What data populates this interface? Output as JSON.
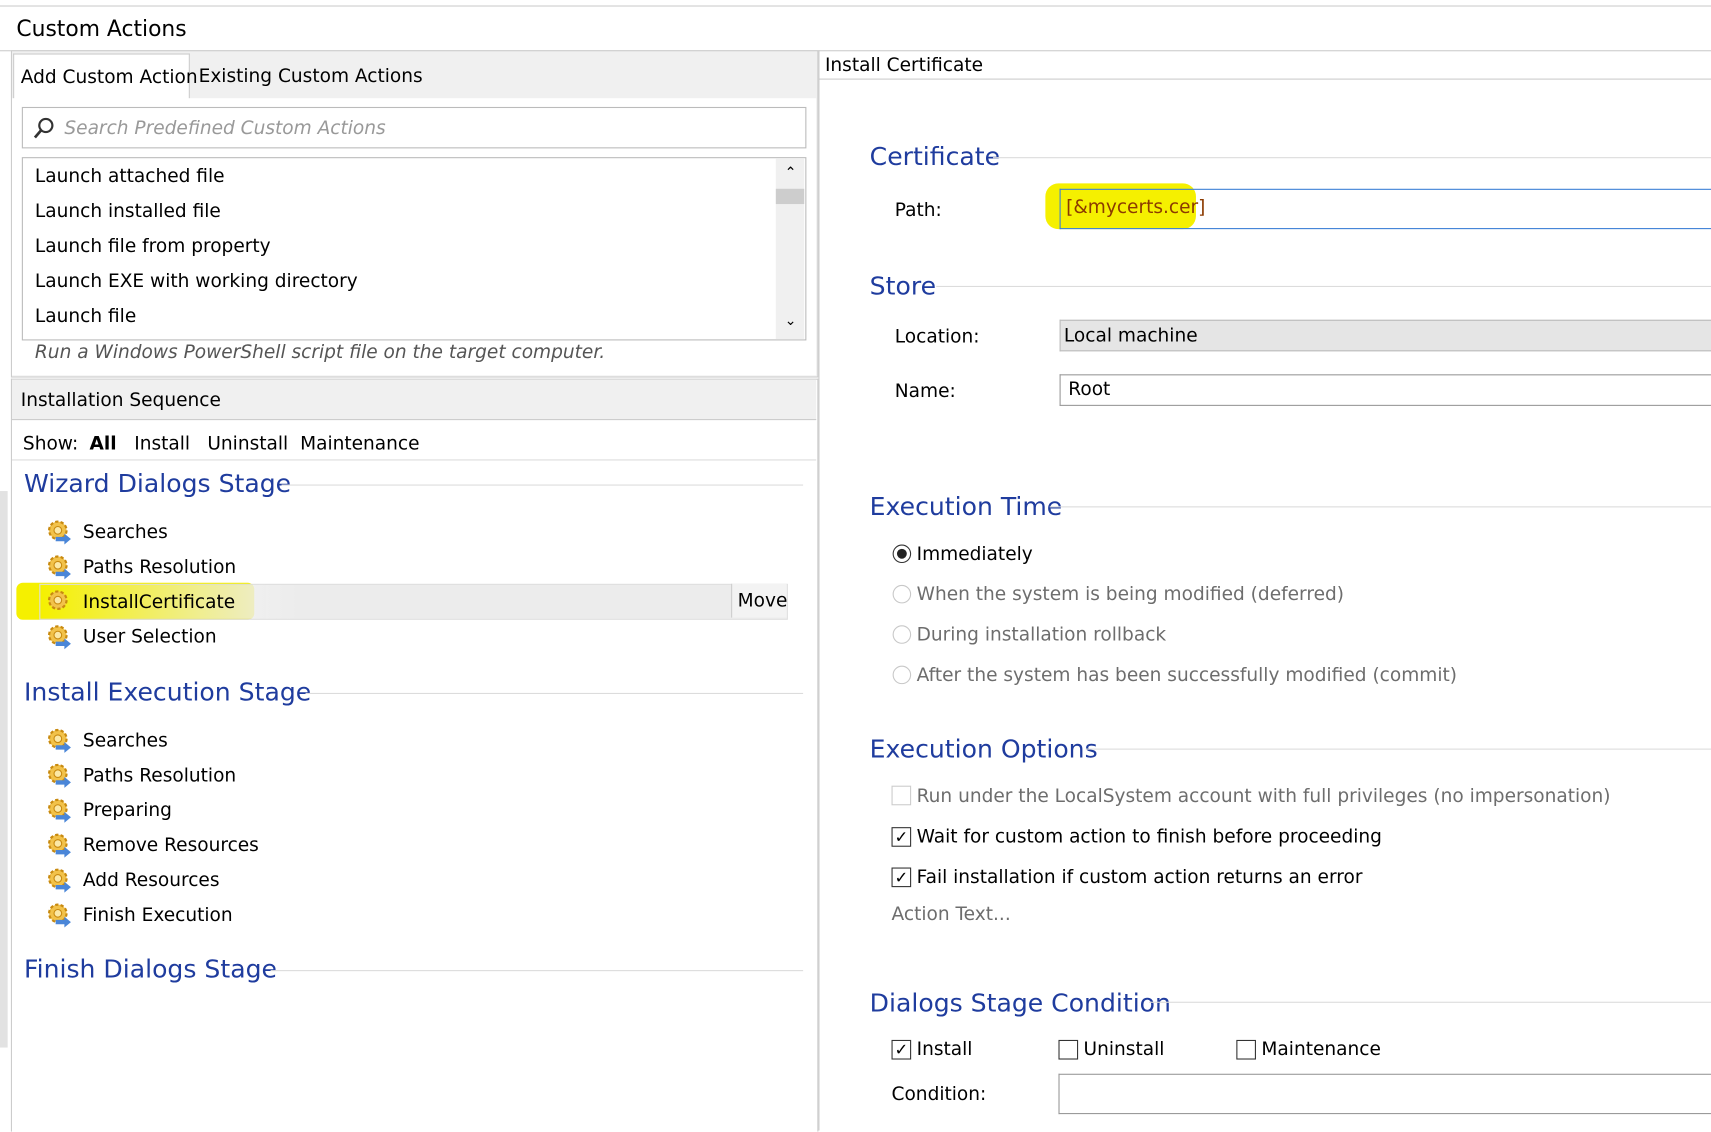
{
  "header": {
    "title": "Custom Actions"
  },
  "tabs": [
    {
      "label": "Add Custom Action",
      "active": true
    },
    {
      "label": "Existing Custom Actions",
      "active": false
    }
  ],
  "search": {
    "placeholder": "Search Predefined Custom Actions",
    "icon": "search-icon"
  },
  "predefined_list": [
    "Launch attached file",
    "Launch installed file",
    "Launch file from property",
    "Launch EXE with working directory",
    "Launch file"
  ],
  "description": "Run a Windows PowerShell script file on the target computer.",
  "sequence": {
    "title": "Installation Sequence",
    "show_label": "Show:",
    "filters": [
      {
        "label": "All",
        "active": true
      },
      {
        "label": "Install"
      },
      {
        "label": "Uninstall"
      },
      {
        "label": "Maintenance"
      }
    ],
    "stages": [
      {
        "title": "Wizard Dialogs Stage",
        "items": [
          "Searches",
          "Paths Resolution",
          "InstallCertificate",
          "User Selection"
        ]
      },
      {
        "title": "Install Execution Stage",
        "items": [
          "Searches",
          "Paths Resolution",
          "Preparing",
          "Remove Resources",
          "Add Resources",
          "Finish Execution"
        ]
      },
      {
        "title": "Finish Dialogs Stage",
        "items": []
      }
    ],
    "selected_item": "InstallCertificate",
    "move_label": "Move",
    "highlight_color": "#f5f000"
  },
  "details": {
    "title": "Install Certificate",
    "certificate": {
      "heading": "Certificate",
      "path_label": "Path:",
      "path_value": "[&mycerts.cer]"
    },
    "store": {
      "heading": "Store",
      "location_label": "Location:",
      "location_value": "Local machine",
      "name_label": "Name:",
      "name_value": "Root"
    },
    "execution_time": {
      "heading": "Execution Time",
      "options": [
        {
          "label": "Immediately",
          "selected": true,
          "enabled": true
        },
        {
          "label": "When the system is being modified (deferred)",
          "selected": false,
          "enabled": false
        },
        {
          "label": "During installation rollback",
          "selected": false,
          "enabled": false
        },
        {
          "label": "After the system has been successfully modified (commit)",
          "selected": false,
          "enabled": false
        }
      ]
    },
    "execution_options": {
      "heading": "Execution Options",
      "options": [
        {
          "label": "Run under the LocalSystem account with full privileges (no impersonation)",
          "checked": false,
          "enabled": false
        },
        {
          "label": "Wait for custom action to finish before proceeding",
          "checked": true,
          "enabled": true
        },
        {
          "label": "Fail installation if custom action returns an error",
          "checked": true,
          "enabled": true
        }
      ],
      "action_text_label": "Action Text..."
    },
    "dialogs_condition": {
      "heading": "Dialogs Stage Condition",
      "checks": [
        {
          "label": "Install",
          "checked": true
        },
        {
          "label": "Uninstall",
          "checked": false
        },
        {
          "label": "Maintenance",
          "checked": false
        }
      ],
      "condition_label": "Condition:",
      "condition_value": ""
    }
  },
  "colors": {
    "heading": "#1f3c9e",
    "highlight": "#f5f000",
    "focus_border": "#3c7fd6"
  }
}
